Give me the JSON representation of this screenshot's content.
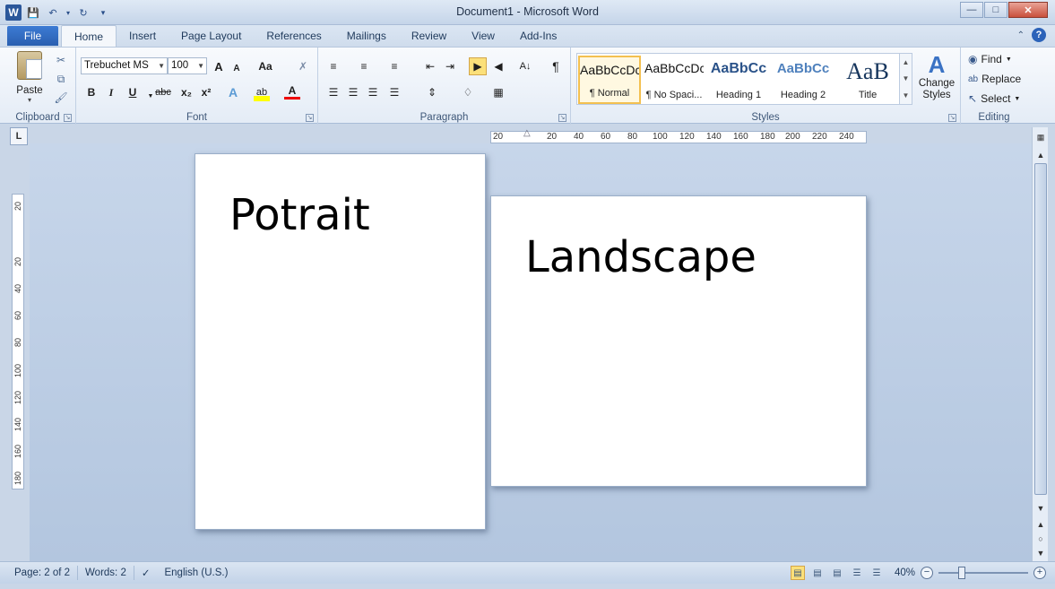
{
  "titlebar": {
    "title": "Document1  -  Microsoft Word",
    "qat_icons": [
      "word-logo",
      "save-icon",
      "undo-icon",
      "redo-icon",
      "customize-icon"
    ],
    "window_buttons": [
      "minimize",
      "maximize",
      "close"
    ]
  },
  "tabs": {
    "file": "File",
    "items": [
      "Home",
      "Insert",
      "Page Layout",
      "References",
      "Mailings",
      "Review",
      "View",
      "Add-Ins"
    ],
    "active": "Home"
  },
  "ribbon": {
    "clipboard": {
      "label": "Clipboard",
      "paste": "Paste"
    },
    "font": {
      "label": "Font",
      "font_name": "Trebuchet MS",
      "font_size": "100",
      "bold": "B",
      "italic": "I",
      "underline": "U",
      "strike": "abc",
      "subscript": "x₂",
      "superscript": "x²",
      "change_case": "Aa",
      "grow": "A",
      "shrink": "A"
    },
    "paragraph": {
      "label": "Paragraph",
      "pilcrow": "¶"
    },
    "styles": {
      "label": "Styles",
      "items": [
        {
          "preview": "AaBbCcDc",
          "name": "¶ Normal"
        },
        {
          "preview": "AaBbCcDc",
          "name": "¶ No Spaci..."
        },
        {
          "preview": "AaBbCc",
          "name": "Heading 1"
        },
        {
          "preview": "AaBbCc",
          "name": "Heading 2"
        },
        {
          "preview": "AaB",
          "name": "Title"
        }
      ],
      "change_styles": "Change Styles"
    },
    "editing": {
      "label": "Editing",
      "find": "Find",
      "replace": "Replace",
      "select": "Select"
    }
  },
  "ruler": {
    "h_ticks": [
      "20",
      "20",
      "40",
      "60",
      "80",
      "100",
      "120",
      "140",
      "160",
      "180",
      "200",
      "220",
      "240"
    ],
    "v_ticks": [
      "20",
      "20",
      "40",
      "60",
      "80",
      "100",
      "120",
      "140",
      "160",
      "180"
    ]
  },
  "document": {
    "page1_text": "Potrait",
    "page2_text": "Landscape"
  },
  "statusbar": {
    "page": "Page: 2 of 2",
    "words": "Words: 2",
    "language": "English (U.S.)",
    "zoom": "40%"
  },
  "colors": {
    "accent": "#2b579a",
    "file_tab": "#2a5fb0",
    "selected_style": "#f3c050"
  }
}
